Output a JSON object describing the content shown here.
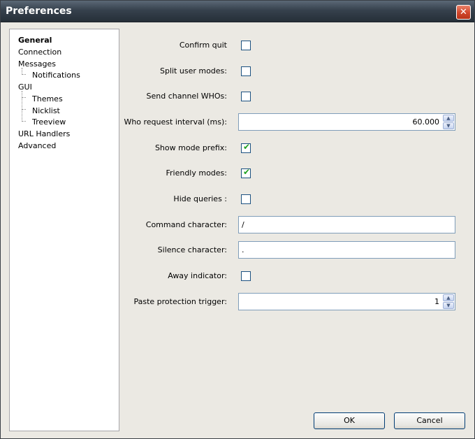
{
  "window": {
    "title": "Preferences",
    "close_label": "✕"
  },
  "sidebar": {
    "items": [
      {
        "label": "General"
      },
      {
        "label": "Connection"
      },
      {
        "label": "Messages"
      },
      {
        "label": "Notifications"
      },
      {
        "label": "GUI"
      },
      {
        "label": "Themes"
      },
      {
        "label": "Nicklist"
      },
      {
        "label": "Treeview"
      },
      {
        "label": "URL Handlers"
      },
      {
        "label": "Advanced"
      }
    ],
    "selected": "General"
  },
  "form": {
    "confirm_quit": {
      "label": "Confirm quit",
      "checked": false
    },
    "split_user_modes": {
      "label": "Split user modes:",
      "checked": false
    },
    "send_channel_whos": {
      "label": "Send channel WHOs:",
      "checked": false
    },
    "who_request_interval": {
      "label": "Who request interval (ms):",
      "value": "60.000"
    },
    "show_mode_prefix": {
      "label": "Show mode prefix:",
      "checked": true
    },
    "friendly_modes": {
      "label": "Friendly modes:",
      "checked": true
    },
    "hide_queries": {
      "label": "Hide queries :",
      "checked": false
    },
    "command_character": {
      "label": "Command character:",
      "value": "/"
    },
    "silence_character": {
      "label": "Silence character:",
      "value": "."
    },
    "away_indicator": {
      "label": "Away indicator:",
      "checked": false
    },
    "paste_protection_trigger": {
      "label": "Paste protection trigger:",
      "value": "1"
    }
  },
  "buttons": {
    "ok": "OK",
    "cancel": "Cancel"
  },
  "glyphs": {
    "check": "✔",
    "up": "▲",
    "down": "▼"
  },
  "colors": {
    "checkmark": "#21a121",
    "checkbox_border": "#1c5180",
    "button_border": "#003c74"
  }
}
